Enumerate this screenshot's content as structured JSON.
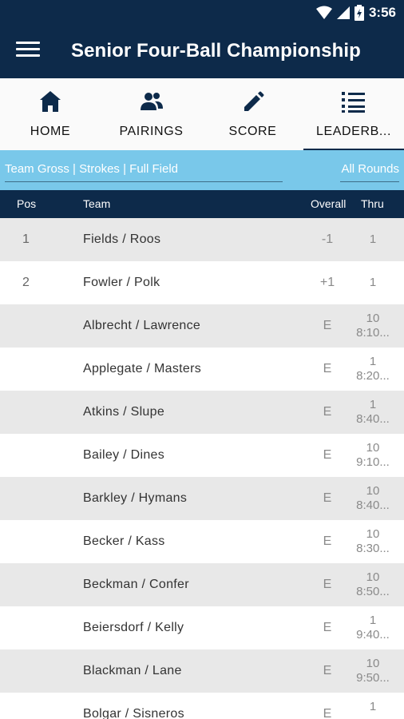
{
  "status_bar": {
    "time": "3:56"
  },
  "app_bar": {
    "title": "Senior Four-Ball Championship"
  },
  "tabs": [
    {
      "label": "HOME",
      "icon": "home-icon"
    },
    {
      "label": "PAIRINGS",
      "icon": "people-icon"
    },
    {
      "label": "SCORE",
      "icon": "pencil-icon"
    },
    {
      "label": "LEADERB...",
      "icon": "list-icon"
    }
  ],
  "active_tab": "LEADERB...",
  "filters": {
    "left": "Team Gross | Strokes | Full Field",
    "right": "All Rounds"
  },
  "table": {
    "headers": {
      "pos": "Pos",
      "team": "Team",
      "overall": "Overall",
      "thru": "Thru"
    },
    "rows": [
      {
        "pos": "1",
        "team": "Fields / Roos",
        "overall": "-1",
        "thru": "1",
        "time": ""
      },
      {
        "pos": "2",
        "team": "Fowler / Polk",
        "overall": "+1",
        "thru": "1",
        "time": ""
      },
      {
        "pos": "",
        "team": "Albrecht / Lawrence",
        "overall": "E",
        "thru": "10",
        "time": "8:10..."
      },
      {
        "pos": "",
        "team": "Applegate / Masters",
        "overall": "E",
        "thru": "1",
        "time": "8:20..."
      },
      {
        "pos": "",
        "team": "Atkins / Slupe",
        "overall": "E",
        "thru": "1",
        "time": "8:40..."
      },
      {
        "pos": "",
        "team": "Bailey / Dines",
        "overall": "E",
        "thru": "10",
        "time": "9:10..."
      },
      {
        "pos": "",
        "team": "Barkley / Hymans",
        "overall": "E",
        "thru": "10",
        "time": "8:40..."
      },
      {
        "pos": "",
        "team": "Becker / Kass",
        "overall": "E",
        "thru": "10",
        "time": "8:30..."
      },
      {
        "pos": "",
        "team": "Beckman / Confer",
        "overall": "E",
        "thru": "10",
        "time": "8:50..."
      },
      {
        "pos": "",
        "team": "Beiersdorf / Kelly",
        "overall": "E",
        "thru": "1",
        "time": "9:40..."
      },
      {
        "pos": "",
        "team": "Blackman / Lane",
        "overall": "E",
        "thru": "10",
        "time": "9:50..."
      },
      {
        "pos": "",
        "team": "Bolgar / Sisneros",
        "overall": "E",
        "thru": "1",
        "time": ""
      }
    ]
  },
  "colors": {
    "navy": "#0d2a4a",
    "filter_bar": "#79c8ea",
    "row_grey": "#e8e8e8"
  }
}
